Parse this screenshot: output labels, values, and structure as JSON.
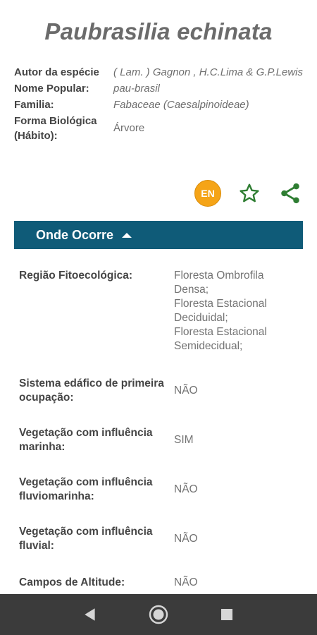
{
  "species": {
    "name": "Paubrasilia echinata"
  },
  "info": [
    {
      "label": "Autor da espécie",
      "value": "( Lam. ) Gagnon , H.C.Lima & G.P.Lewis",
      "italic": true
    },
    {
      "label": "Nome Popular:",
      "value": "pau-brasil",
      "italic": true
    },
    {
      "label": "Familia:",
      "value": "Fabaceae (Caesalpinoideae)",
      "italic": true
    },
    {
      "label": "Forma Biológica (Hábito):",
      "value": "Árvore",
      "italic": false
    }
  ],
  "actions": {
    "language_label": "EN",
    "colors": {
      "badge": "#f5a417",
      "icon": "#2e7d32"
    }
  },
  "section": {
    "title": "Onde Ocorre",
    "bar_color": "#0f5b78"
  },
  "rows": [
    {
      "label": "Região Fitoecológica:",
      "values": [
        "Floresta Ombrofila Densa;",
        "Floresta Estacional Deciduidal;",
        "Floresta Estacional Semidecidual;"
      ]
    },
    {
      "label": "Sistema edáfico de primeira ocupação:",
      "values": [
        "NÃO"
      ]
    },
    {
      "label": "Vegetação com influência marinha:",
      "values": [
        "SIM"
      ]
    },
    {
      "label": "Vegetação com influência fluviomarinha:",
      "values": [
        "NÃO"
      ]
    },
    {
      "label": "Vegetação com influência fluvial:",
      "values": [
        "NÃO"
      ]
    },
    {
      "label": "Campos de Altitude:",
      "values": [
        "NÃO"
      ]
    }
  ]
}
